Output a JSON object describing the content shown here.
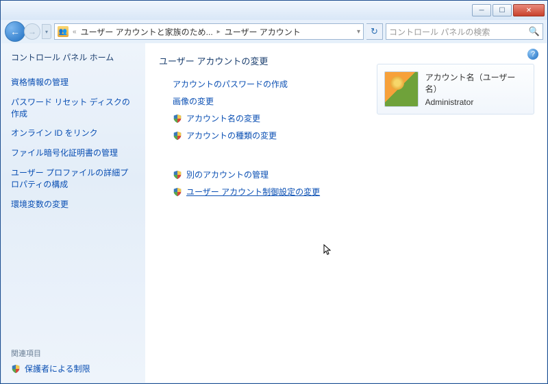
{
  "breadcrumb": {
    "segment1": "ユーザー アカウントと家族のため...",
    "segment2": "ユーザー アカウント"
  },
  "search": {
    "placeholder": "コントロール パネルの検索"
  },
  "sidebar": {
    "home": "コントロール パネル ホーム",
    "links": [
      "資格情報の管理",
      "パスワード リセット ディスクの作成",
      "オンライン ID をリンク",
      "ファイル暗号化証明書の管理",
      "ユーザー プロファイルの詳細プロパティの構成",
      "環境変数の変更"
    ],
    "related_header": "関連項目",
    "related_link": "保護者による制限"
  },
  "main": {
    "heading": "ユーザー アカウントの変更",
    "tasks": [
      {
        "label": "アカウントのパスワードの作成",
        "shield": false
      },
      {
        "label": "画像の変更",
        "shield": false
      },
      {
        "label": "アカウント名の変更",
        "shield": true
      },
      {
        "label": "アカウントの種類の変更",
        "shield": true
      }
    ],
    "tasks2": [
      {
        "label": "別のアカウントの管理",
        "shield": true
      },
      {
        "label": "ユーザー アカウント制御設定の変更",
        "shield": true,
        "hovered": true
      }
    ]
  },
  "account": {
    "name_label": "アカウント名（ユーザー名）",
    "role": "Administrator"
  }
}
